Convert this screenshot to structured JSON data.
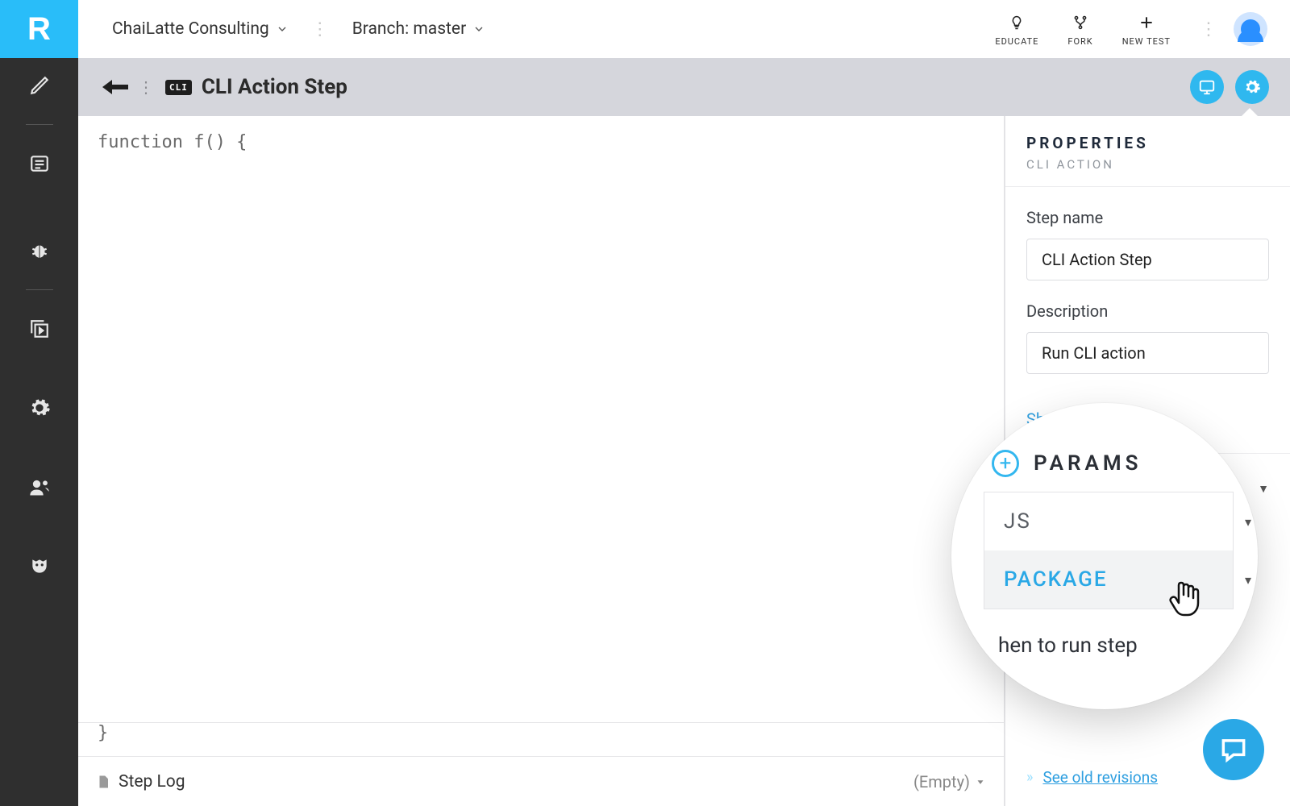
{
  "topbar": {
    "org": "ChaiLatte Consulting",
    "branch_label": "Branch: master",
    "tools": {
      "educate": "EDUCATE",
      "fork": "FORK",
      "newtest": "NEW TEST"
    }
  },
  "subheader": {
    "cli_badge": "CLI",
    "title": "CLI Action Step"
  },
  "editor": {
    "open": "function f() {",
    "close": "}",
    "steplog_title": "Step Log",
    "steplog_status": "(Empty)"
  },
  "properties": {
    "heading": "PROPERTIES",
    "subheading": "CLI ACTION",
    "stepname_label": "Step name",
    "stepname_value": "CLI Action Step",
    "description_label": "Description",
    "description_value": "Run CLI action",
    "share_label": "Share step",
    "params_label": "PARAMS",
    "revisions_label": "See old revisions"
  },
  "lens": {
    "params_label": "PARAMS",
    "options": [
      "JS",
      "PACKAGE"
    ],
    "when_label": "hen to run step"
  },
  "rail": {
    "logo": "R"
  }
}
